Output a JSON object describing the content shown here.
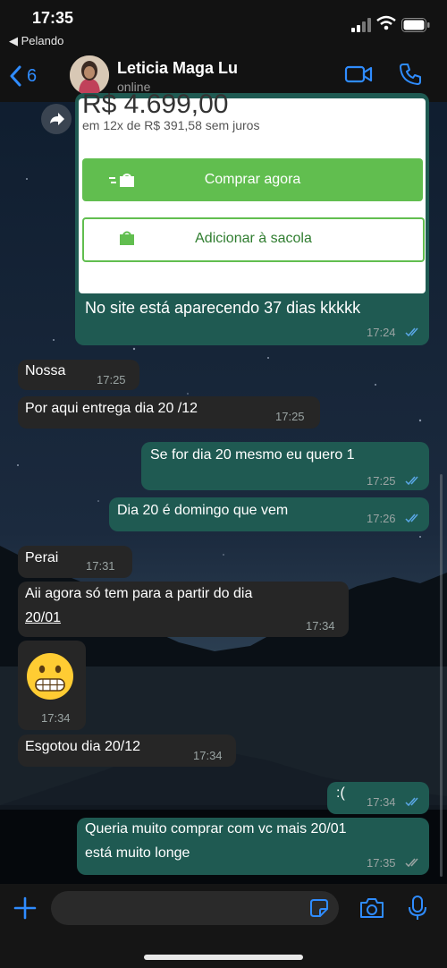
{
  "status_bar": {
    "time": "17:35",
    "back_app": "◀ Pelando"
  },
  "header": {
    "back_count": "6",
    "contact_name": "Leticia Maga Lu",
    "presence": "online"
  },
  "product_card": {
    "price": "R$ 4.699,00",
    "installments": "em 12x de R$ 391,58 sem juros",
    "buy_label": "Comprar agora",
    "bag_label": "Adicionar à sacola",
    "accent": "#61be4f"
  },
  "messages": [
    {
      "dir": "out",
      "text": "No site está aparecendo 37 dias kkkkk",
      "time": "17:24"
    },
    {
      "dir": "in",
      "text": "Nossa",
      "time": "17:25"
    },
    {
      "dir": "in",
      "text": "Por aqui entrega dia 20 /12",
      "time": "17:25"
    },
    {
      "dir": "out",
      "text": "Se for dia 20 mesmo eu quero 1",
      "time": "17:25"
    },
    {
      "dir": "out",
      "text": "Dia 20 é domingo que vem",
      "time": "17:26"
    },
    {
      "dir": "in",
      "text": "Perai",
      "time": "17:31"
    },
    {
      "dir": "in",
      "text_lines": [
        "Aii agora só tem para a partir do dia",
        "20/01"
      ],
      "time": "17:34"
    },
    {
      "dir": "in",
      "emoji": "😬",
      "time": "17:34"
    },
    {
      "dir": "in",
      "text": "Esgotou dia 20/12",
      "time": "17:34"
    },
    {
      "dir": "out",
      "text": ":(",
      "time": "17:34"
    },
    {
      "dir": "out",
      "text_lines": [
        "Queria muito comprar com vc mais 20/01",
        "está muito longe"
      ],
      "time": "17:35"
    }
  ],
  "colors": {
    "incoming": "#262626",
    "outgoing": "#1f5a52",
    "ios_blue": "#2f8cff"
  }
}
